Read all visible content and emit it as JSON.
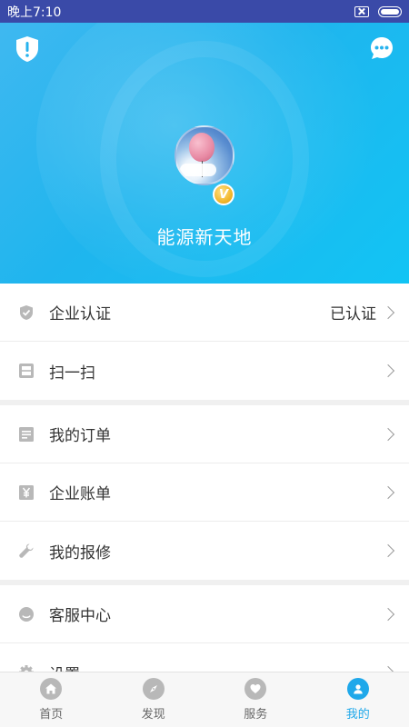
{
  "status_bar": {
    "time": "晚上7:10",
    "icons": [
      "sim-off-icon",
      "battery-icon"
    ]
  },
  "header": {
    "username": "能源新天地",
    "badge": "V",
    "left_icon": "shield-alert-icon",
    "right_icon": "chat-bubble-icon",
    "gradient_colors": [
      "#3fb8f0",
      "#12c4f4"
    ]
  },
  "menu": {
    "items": [
      {
        "label": "企业认证",
        "value": "已认证",
        "icon": "shield-check-icon"
      },
      {
        "label": "扫一扫",
        "value": "",
        "icon": "scan-icon"
      },
      {
        "label": "我的订单",
        "value": "",
        "icon": "order-list-icon"
      },
      {
        "label": "企业账单",
        "value": "",
        "icon": "yuan-bill-icon"
      },
      {
        "label": "我的报修",
        "value": "",
        "icon": "wrench-icon"
      },
      {
        "label": "客服中心",
        "value": "",
        "icon": "customer-service-icon"
      },
      {
        "label": "设置",
        "value": "",
        "icon": "gear-icon"
      }
    ]
  },
  "tabbar": {
    "active": "我的",
    "accent_color": "#1fa8ea",
    "tabs": [
      {
        "label": "首页",
        "icon": "home-icon"
      },
      {
        "label": "发现",
        "icon": "compass-icon"
      },
      {
        "label": "服务",
        "icon": "heart-icon"
      },
      {
        "label": "我的",
        "icon": "user-icon"
      }
    ]
  }
}
